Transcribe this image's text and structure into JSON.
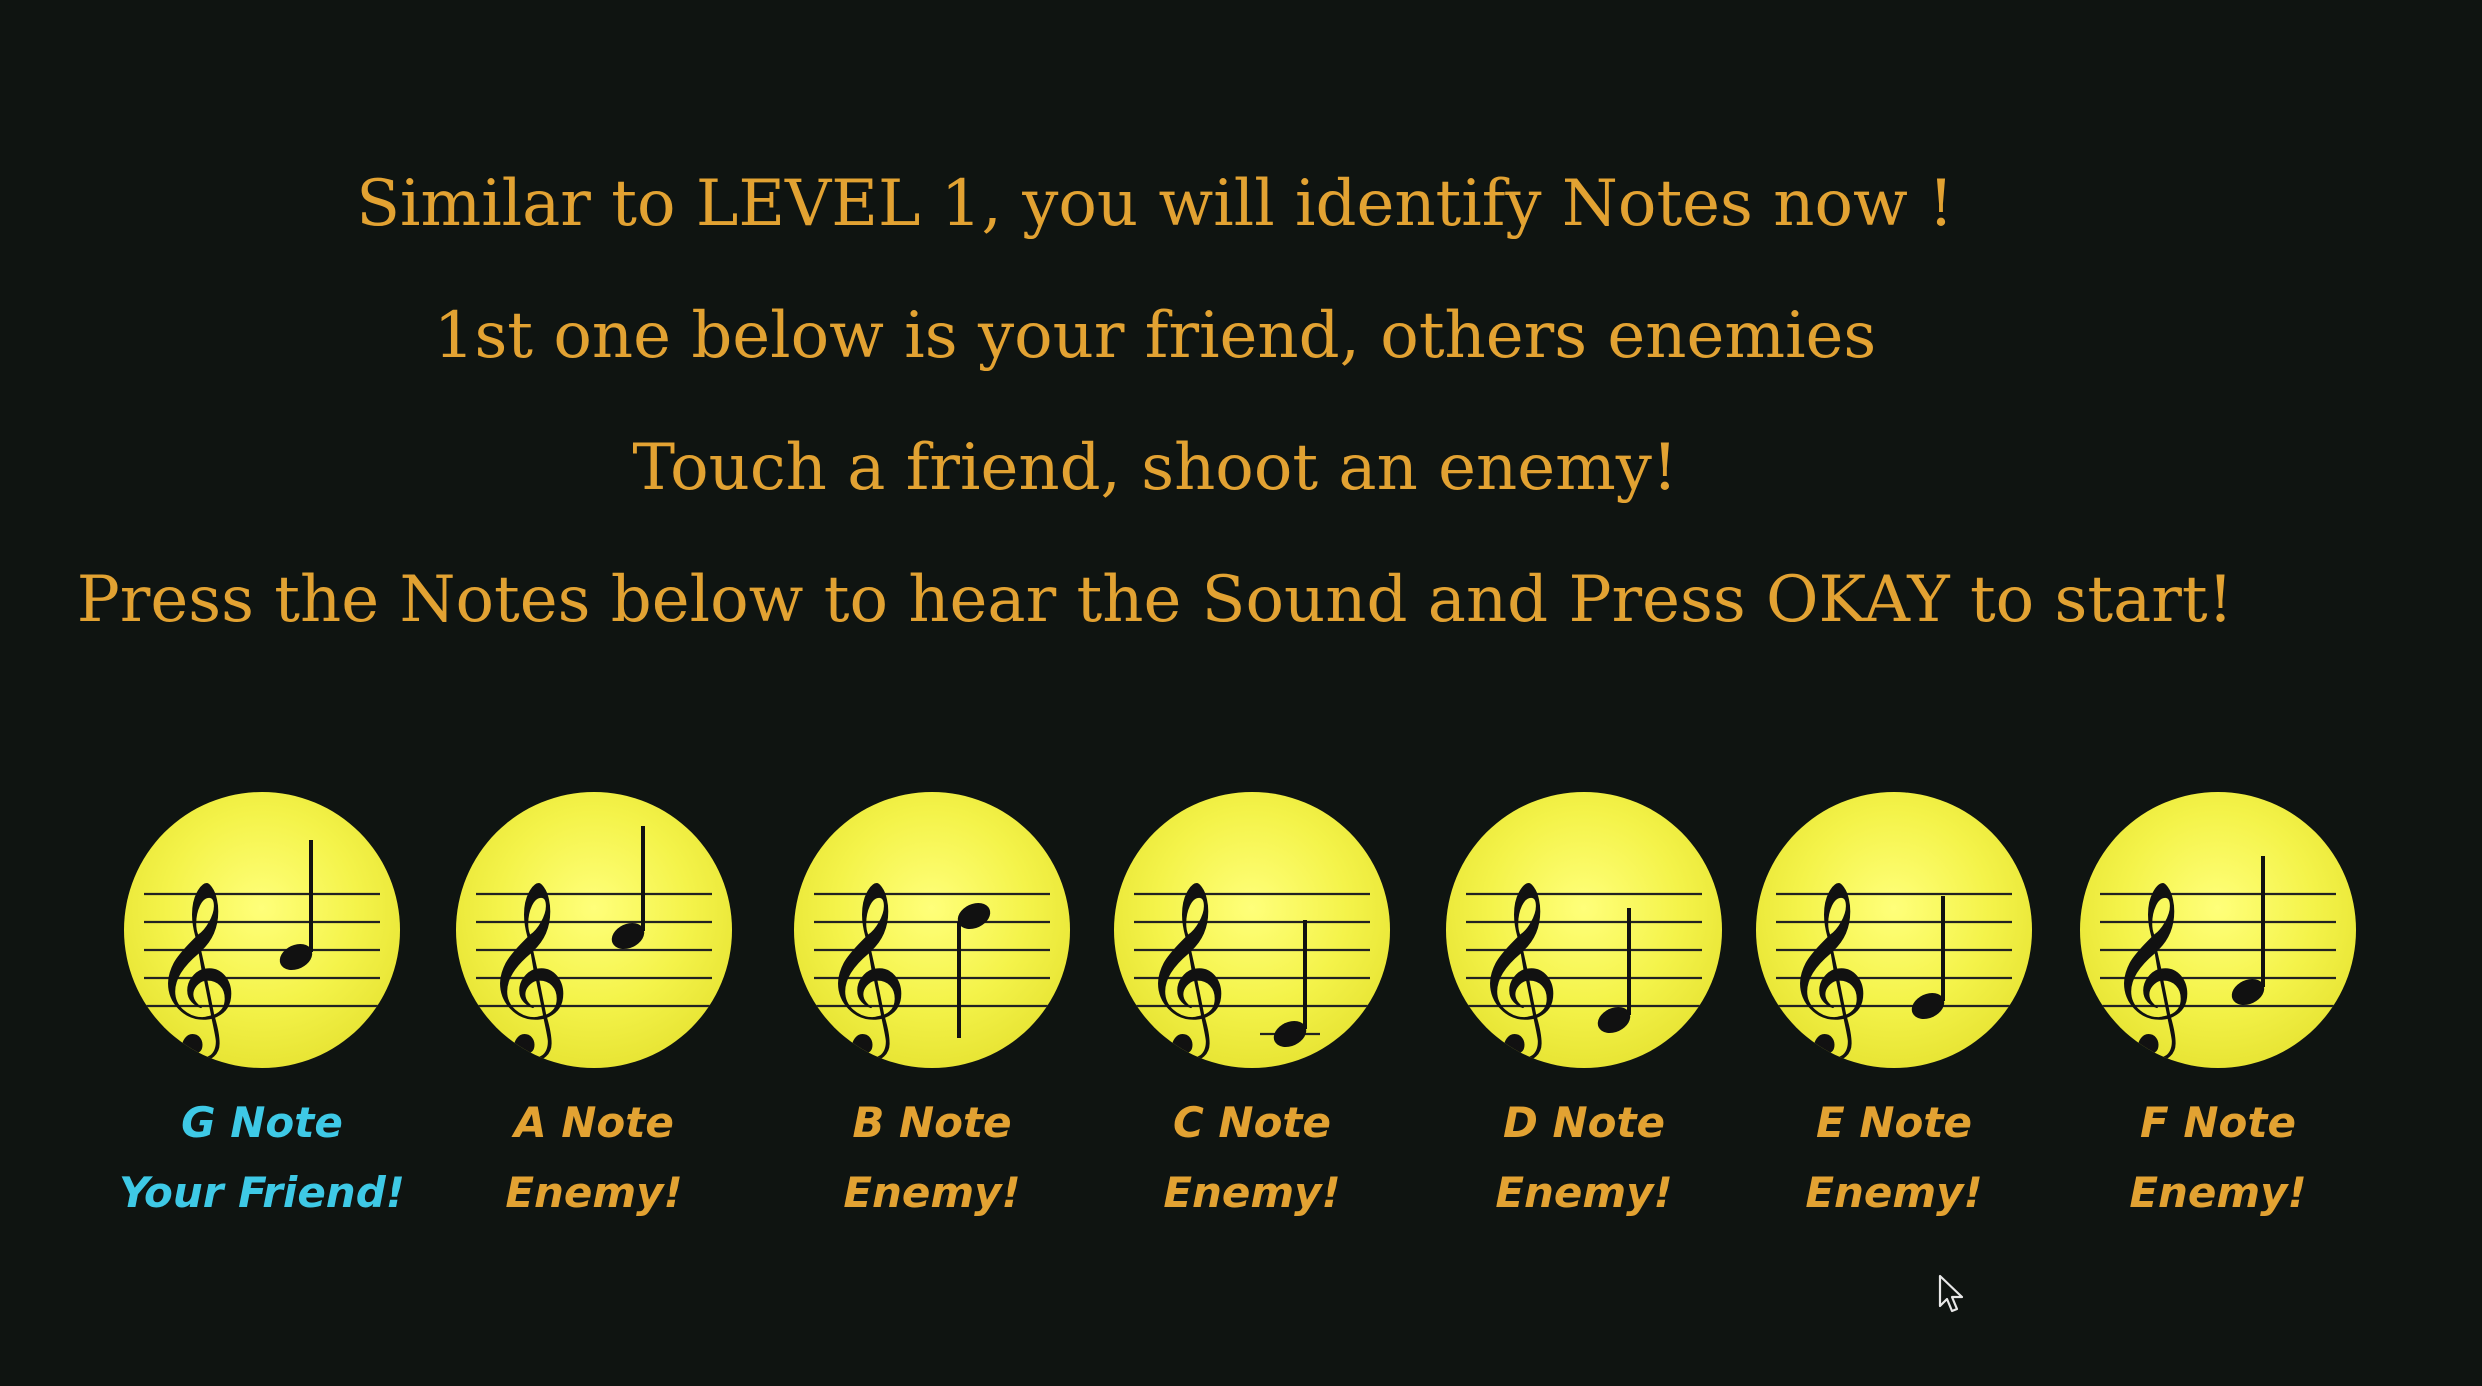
{
  "instructions": {
    "line1": "Similar to LEVEL 1, you will identify Notes now !",
    "line2": "1st one below is your friend, others enemies",
    "line3": "Touch a friend, shoot an enemy!",
    "line4": "Press the Notes below to hear the Sound and Press OKAY to start!"
  },
  "colors": {
    "background": "#0f1411",
    "text": "#e2a232",
    "friend": "#3ec9e6",
    "ball": "#f4f34a"
  },
  "notes": [
    {
      "name": "G Note",
      "role": "Your Friend!",
      "type": "friend"
    },
    {
      "name": "A Note",
      "role": "Enemy!",
      "type": "enemy"
    },
    {
      "name": "B Note",
      "role": "Enemy!",
      "type": "enemy"
    },
    {
      "name": "C Note",
      "role": "Enemy!",
      "type": "enemy"
    },
    {
      "name": "D Note",
      "role": "Enemy!",
      "type": "enemy"
    },
    {
      "name": "E Note",
      "role": "Enemy!",
      "type": "enemy"
    },
    {
      "name": "F Note",
      "role": "Enemy!",
      "type": "enemy"
    }
  ],
  "icons": {
    "note_ball": "treble-clef-staff-note-icon",
    "cursor": "mouse-pointer-icon"
  }
}
